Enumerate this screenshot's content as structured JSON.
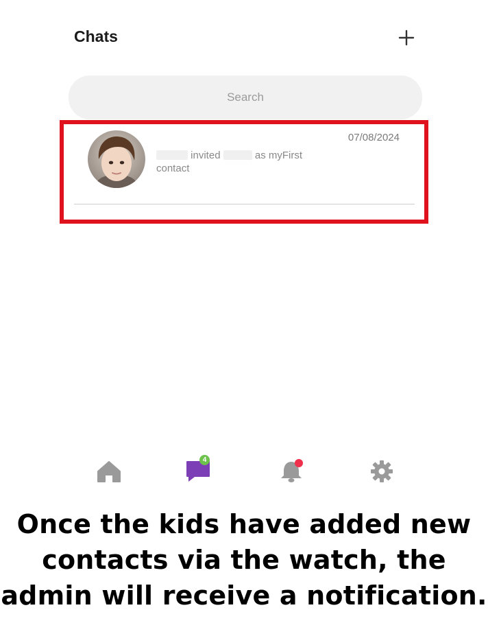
{
  "header": {
    "title": "Chats",
    "add_icon": "plus-icon"
  },
  "search": {
    "placeholder": "Search"
  },
  "chat_list": [
    {
      "avatar": "child-avatar",
      "date": "07/08/2024",
      "message_word1": "invited",
      "message_word2": "as myFirst",
      "message_word3": "contact"
    }
  ],
  "highlight_color": "#e0121e",
  "bottom_nav": {
    "home_icon": "home-icon",
    "chat_icon": "chat-bubble-icon",
    "chat_badge": "4",
    "bell_icon": "bell-icon",
    "settings_icon": "gear-icon",
    "active_color": "#7d3fb5",
    "inactive_color": "#9a9a9a"
  },
  "caption": {
    "line1": "Once the kids have added new",
    "line2": "contacts via the watch, the",
    "line3": "admin will receive a notification."
  }
}
